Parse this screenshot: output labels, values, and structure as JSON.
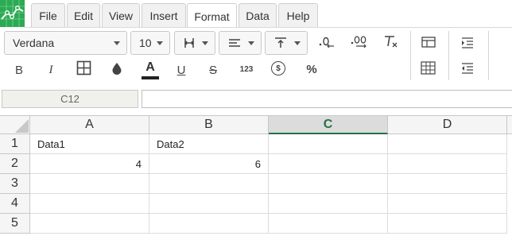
{
  "app": {
    "logo_icon": "spreadsheet-logo-icon",
    "brand_color": "#2bab53"
  },
  "menu": {
    "items": [
      {
        "label": "File"
      },
      {
        "label": "Edit"
      },
      {
        "label": "View"
      },
      {
        "label": "Insert"
      },
      {
        "label": "Format",
        "active": true
      },
      {
        "label": "Data"
      },
      {
        "label": "Help"
      }
    ]
  },
  "toolbar": {
    "font_family": "Verdana",
    "font_size": "10",
    "bold": "B",
    "italic": "I",
    "underline": "U",
    "strikethrough": "S",
    "number_format": "123",
    "currency": "$",
    "percent": "%",
    "text_color": "#222222",
    "icons": [
      "borders-icon",
      "fill-color-icon",
      "text-color-icon",
      "merge-icon",
      "align-icon",
      "valign-icon",
      "decrease-decimals-icon",
      "increase-decimals-icon",
      "clear-format-icon",
      "table-icon",
      "grid-icon",
      "indent-icon",
      "outdent-icon"
    ]
  },
  "formula_bar": {
    "cell_ref": "C12",
    "value": ""
  },
  "sheet": {
    "columns": [
      "A",
      "B",
      "C",
      "D"
    ],
    "selected_column": "C",
    "accent": "#217346",
    "rows": [
      {
        "num": "1",
        "cells": [
          "Data1",
          "Data2",
          "",
          ""
        ]
      },
      {
        "num": "2",
        "cells": [
          "4",
          "6",
          "",
          ""
        ]
      },
      {
        "num": "3",
        "cells": [
          "",
          "",
          "",
          ""
        ]
      },
      {
        "num": "4",
        "cells": [
          "",
          "",
          "",
          ""
        ]
      },
      {
        "num": "5",
        "cells": [
          "",
          "",
          "",
          ""
        ]
      }
    ]
  }
}
